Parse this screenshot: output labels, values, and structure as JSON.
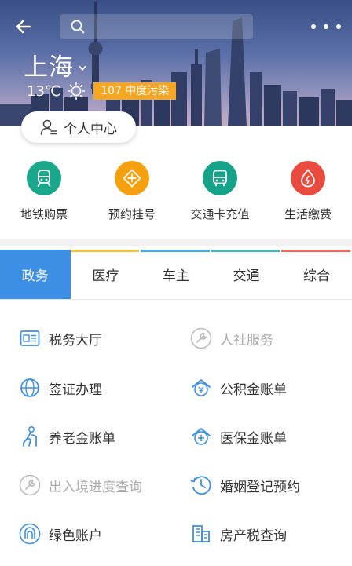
{
  "header": {
    "search": {
      "placeholder": ""
    },
    "city": "上海",
    "weather": {
      "temperature": "13℃",
      "aqi_text": "107 中度污染",
      "aqi_color": "#f5a623"
    },
    "personal_center_label": "个人中心"
  },
  "icons": {
    "back": "back-arrow-icon",
    "search": "search-icon",
    "more": "more-icon",
    "sun": "sun-icon",
    "user": "user-profile-icon"
  },
  "quick_services": [
    {
      "label": "地铁购票",
      "icon": "metro-train-icon",
      "color": "#1aa88a"
    },
    {
      "label": "预约挂号",
      "icon": "medical-cross-icon",
      "color": "#f5a10f"
    },
    {
      "label": "交通卡充值",
      "icon": "bus-card-icon",
      "color": "#15a389"
    },
    {
      "label": "生活缴费",
      "icon": "utility-drop-icon",
      "color": "#ea4b3e"
    }
  ],
  "tabs": [
    {
      "label": "政务",
      "accent": "#3d8fe6",
      "active": true
    },
    {
      "label": "医疗",
      "accent": "#f5c342",
      "active": false
    },
    {
      "label": "车主",
      "accent": "#4aa9e8",
      "active": false
    },
    {
      "label": "交通",
      "accent": "#45b8b0",
      "active": false
    },
    {
      "label": "综合",
      "accent": "#ee6a5e",
      "active": false
    }
  ],
  "services": [
    {
      "label": "税务大厅",
      "icon": "tax-icon",
      "enabled": true
    },
    {
      "label": "人社服务",
      "icon": "wrench-icon",
      "enabled": false
    },
    {
      "label": "签证办理",
      "icon": "globe-icon",
      "enabled": true
    },
    {
      "label": "公积金账单",
      "icon": "house-fund-icon",
      "enabled": true
    },
    {
      "label": "养老金账单",
      "icon": "elder-icon",
      "enabled": true
    },
    {
      "label": "医保金账单",
      "icon": "medical-insurance-icon",
      "enabled": true
    },
    {
      "label": "出入境进度查询",
      "icon": "wrench-icon",
      "enabled": false
    },
    {
      "label": "婚姻登记预约",
      "icon": "clock-history-icon",
      "enabled": true
    },
    {
      "label": "绿色账户",
      "icon": "green-account-icon",
      "enabled": true
    },
    {
      "label": "房产税查询",
      "icon": "building-icon",
      "enabled": true
    }
  ],
  "colors": {
    "primary": "#3d8fe6",
    "icon_blue": "#3d8fe6",
    "disabled": "#aaaaaa"
  }
}
